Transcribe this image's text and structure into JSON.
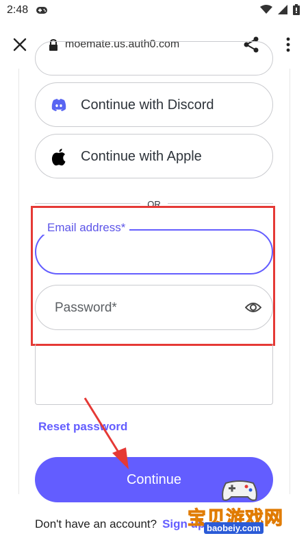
{
  "status_bar": {
    "time": "2:48",
    "icons": [
      "gamepad-icon",
      "wifi-icon",
      "signal-icon",
      "battery-icon"
    ]
  },
  "browser": {
    "url": "moemate.us.auth0.com",
    "icons": [
      "close-icon",
      "lock-icon",
      "share-icon",
      "more-vert-icon"
    ]
  },
  "login": {
    "social_buttons": [
      {
        "label": "Continue with Discord",
        "icon": "discord-icon",
        "color": "#5865f2"
      },
      {
        "label": "Continue with Apple",
        "icon": "apple-icon",
        "color": "#000000"
      }
    ],
    "divider_text": "OR",
    "email": {
      "label": "Email address*",
      "value": ""
    },
    "password": {
      "placeholder": "Password*",
      "icon": "eye-icon"
    },
    "reset_link": "Reset password",
    "continue_label": "Continue",
    "signup_prompt": "Don't have an account?",
    "signup_link": "Sign up"
  },
  "watermark": {
    "title": "宝贝游戏网",
    "url": "baobeiy.com"
  },
  "colors": {
    "accent": "#635dff",
    "highlight": "#e53935",
    "border": "#c9cace"
  }
}
